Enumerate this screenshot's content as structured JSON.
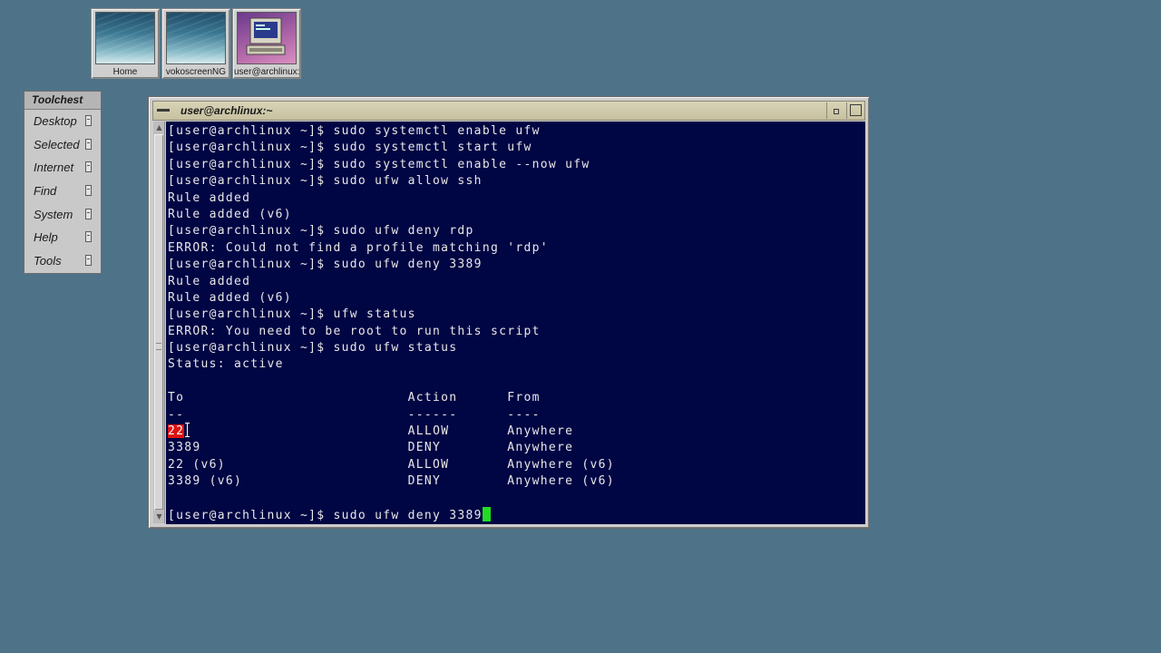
{
  "desktop_icons": [
    {
      "label": "Home",
      "icon": "home-folder-icon"
    },
    {
      "label": "vokoscreenNG",
      "icon": "vokoscreen-icon"
    },
    {
      "label": "user@archlinux:~",
      "icon": "terminal-icon"
    }
  ],
  "toolchest": {
    "title": "Toolchest",
    "items": [
      "Desktop",
      "Selected",
      "Internet",
      "Find",
      "System",
      "Help",
      "Tools"
    ]
  },
  "window": {
    "title": "user@archlinux:~"
  },
  "terminal": {
    "lines": [
      "[user@archlinux ~]$ sudo systemctl enable ufw",
      "[user@archlinux ~]$ sudo systemctl start ufw",
      "[user@archlinux ~]$ sudo systemctl enable --now ufw",
      "[user@archlinux ~]$ sudo ufw allow ssh",
      "Rule added",
      "Rule added (v6)",
      "[user@archlinux ~]$ sudo ufw deny rdp",
      "ERROR: Could not find a profile matching 'rdp'",
      "[user@archlinux ~]$ sudo ufw deny 3389",
      "Rule added",
      "Rule added (v6)",
      "[user@archlinux ~]$ ufw status",
      "ERROR: You need to be root to run this script",
      "[user@archlinux ~]$ sudo ufw status",
      "Status: active",
      "",
      "To                           Action      From",
      "--                           ------      ----",
      "__HL__                           ALLOW       Anywhere",
      "3389                         DENY        Anywhere",
      "22 (v6)                      ALLOW       Anywhere (v6)",
      "3389 (v6)                    DENY        Anywhere (v6)",
      "",
      "[user@archlinux ~]$ sudo ufw deny 3389"
    ],
    "selected_text": "22"
  }
}
